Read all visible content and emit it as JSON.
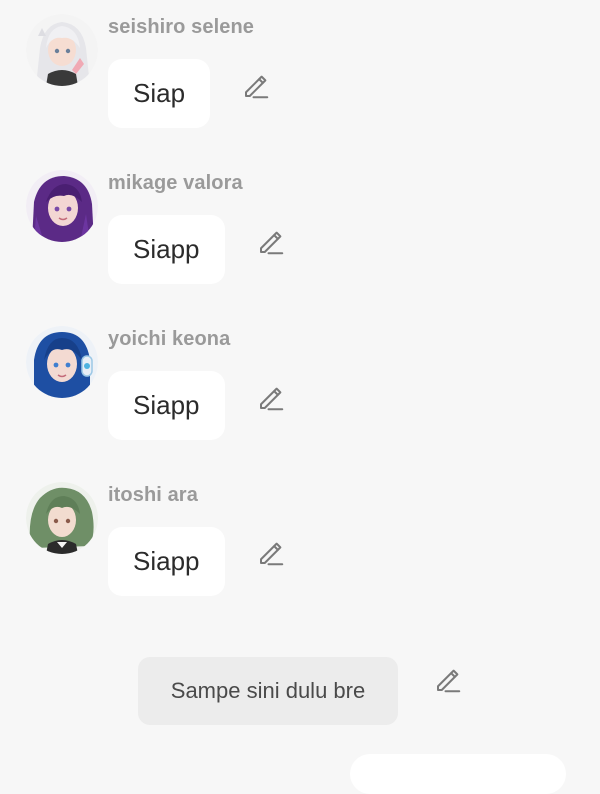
{
  "messages": [
    {
      "sender": "seishiro selene",
      "text": "Siap",
      "avatar_icon": "avatar-silver-hair"
    },
    {
      "sender": "mikage valora",
      "text": "Siapp",
      "avatar_icon": "avatar-purple-hair"
    },
    {
      "sender": "yoichi keona",
      "text": "Siapp",
      "avatar_icon": "avatar-blue-hair-headphones"
    },
    {
      "sender": "itoshi ara",
      "text": "Siapp",
      "avatar_icon": "avatar-green-hair"
    }
  ],
  "user_message": {
    "text": "Sampe sini dulu bre"
  },
  "icons": {
    "edit": "pencil-edit-icon"
  },
  "colors": {
    "background": "#f7f7f7",
    "bubble": "#ffffff",
    "user_bubble": "#ececec",
    "sender_text": "#9a9a9a",
    "message_text": "#2b2b2b",
    "icon": "#7a7a7a"
  }
}
